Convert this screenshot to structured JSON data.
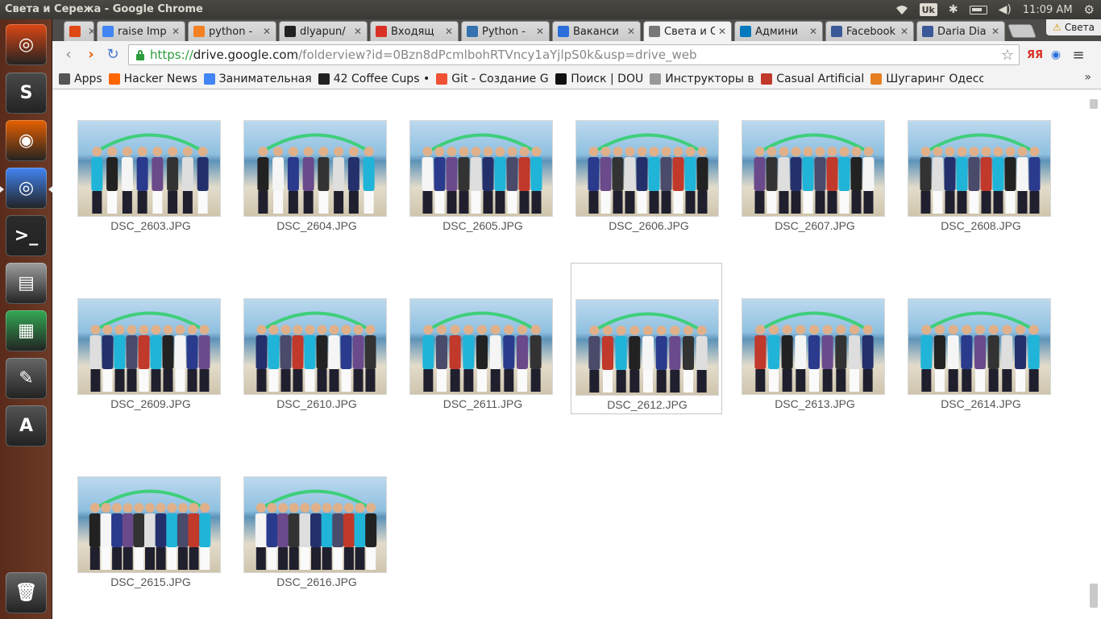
{
  "os": {
    "window_title": "Света и Сережа - Google Chrome",
    "keyboard_layout": "Uk",
    "clock": "11:09 AM",
    "launcher": [
      {
        "name": "ubuntu-dash-icon",
        "color": "#dd4814"
      },
      {
        "name": "sublime-text-icon",
        "color": "#4a4a4a"
      },
      {
        "name": "firefox-icon",
        "color": "#e66000"
      },
      {
        "name": "chrome-icon",
        "color": "#4285f4"
      },
      {
        "name": "terminal-icon",
        "color": "#2b2b2b"
      },
      {
        "name": "file-manager-icon",
        "color": "#9e9e9e"
      },
      {
        "name": "spreadsheet-icon",
        "color": "#33a853"
      },
      {
        "name": "system-settings-icon",
        "color": "#666"
      },
      {
        "name": "software-updater-icon",
        "color": "#555"
      },
      {
        "name": "trash-icon",
        "color": "#666"
      }
    ]
  },
  "browser": {
    "tabs": [
      {
        "label": "",
        "icon": "ubuntu-icon",
        "color": "#dd4814"
      },
      {
        "label": "raise Imp",
        "icon": "google-icon",
        "color": "#4285f4"
      },
      {
        "label": "python -",
        "icon": "stack-overflow-icon",
        "color": "#f48024"
      },
      {
        "label": "dlyapun/",
        "icon": "github-icon",
        "color": "#222"
      },
      {
        "label": "Входящ",
        "icon": "gmail-icon",
        "color": "#d93025"
      },
      {
        "label": "Python -",
        "icon": "jira-icon",
        "color": "#3572b0"
      },
      {
        "label": "Ваканси",
        "icon": "job-site-icon",
        "color": "#2a6fdb"
      },
      {
        "label": "Света и С",
        "icon": "drive-folder-icon",
        "color": "#777"
      },
      {
        "label": "Админи",
        "icon": "trello-icon",
        "color": "#0079bf"
      },
      {
        "label": "Facebook",
        "icon": "facebook-icon",
        "color": "#3b5998"
      },
      {
        "label": "Daria Dia",
        "icon": "facebook-icon",
        "color": "#3b5998"
      }
    ],
    "profile_name": "Света",
    "url": {
      "protocol": "https://",
      "host": "drive.google.com",
      "path": "/folderview?id=0Bzn8dPcmlbohRTVncy1aYjlpS0k&usp=drive_web"
    },
    "bookmarks": [
      {
        "label": "Apps",
        "icon": "apps-grid-icon",
        "color": "#555"
      },
      {
        "label": "Hacker News",
        "icon": "hacker-news-icon",
        "color": "#ff6600"
      },
      {
        "label": "Занимательная ",
        "icon": "google-icon",
        "color": "#4285f4"
      },
      {
        "label": "42 Coffee Cups • ",
        "icon": "coffee-cup-icon",
        "color": "#222"
      },
      {
        "label": "Git - Создание Gi",
        "icon": "git-icon",
        "color": "#f05033"
      },
      {
        "label": "Поиск | DOU",
        "icon": "dou-icon",
        "color": "#111"
      },
      {
        "label": "Инструкторы во",
        "icon": "page-icon",
        "color": "#999"
      },
      {
        "label": "Casual Artificial ",
        "icon": "casual-r-icon",
        "color": "#c0392b"
      },
      {
        "label": "Шугаринг Одесс",
        "icon": "sugaring-icon",
        "color": "#e67e22"
      }
    ]
  },
  "files": [
    {
      "name": "DSC_2603.JPG",
      "people": 8,
      "selected": false
    },
    {
      "name": "DSC_2604.JPG",
      "people": 8,
      "selected": false
    },
    {
      "name": "DSC_2605.JPG",
      "people": 10,
      "selected": false
    },
    {
      "name": "DSC_2606.JPG",
      "people": 10,
      "selected": false
    },
    {
      "name": "DSC_2607.JPG",
      "people": 10,
      "selected": false
    },
    {
      "name": "DSC_2608.JPG",
      "people": 10,
      "selected": false
    },
    {
      "name": "DSC_2609.JPG",
      "people": 10,
      "selected": false
    },
    {
      "name": "DSC_2610.JPG",
      "people": 10,
      "selected": false
    },
    {
      "name": "DSC_2611.JPG",
      "people": 9,
      "selected": false
    },
    {
      "name": "DSC_2612.JPG",
      "people": 9,
      "selected": true
    },
    {
      "name": "DSC_2613.JPG",
      "people": 9,
      "selected": false
    },
    {
      "name": "DSC_2614.JPG",
      "people": 9,
      "selected": false
    },
    {
      "name": "DSC_2615.JPG",
      "people": 11,
      "selected": false
    },
    {
      "name": "DSC_2616.JPG",
      "people": 11,
      "selected": false
    }
  ]
}
